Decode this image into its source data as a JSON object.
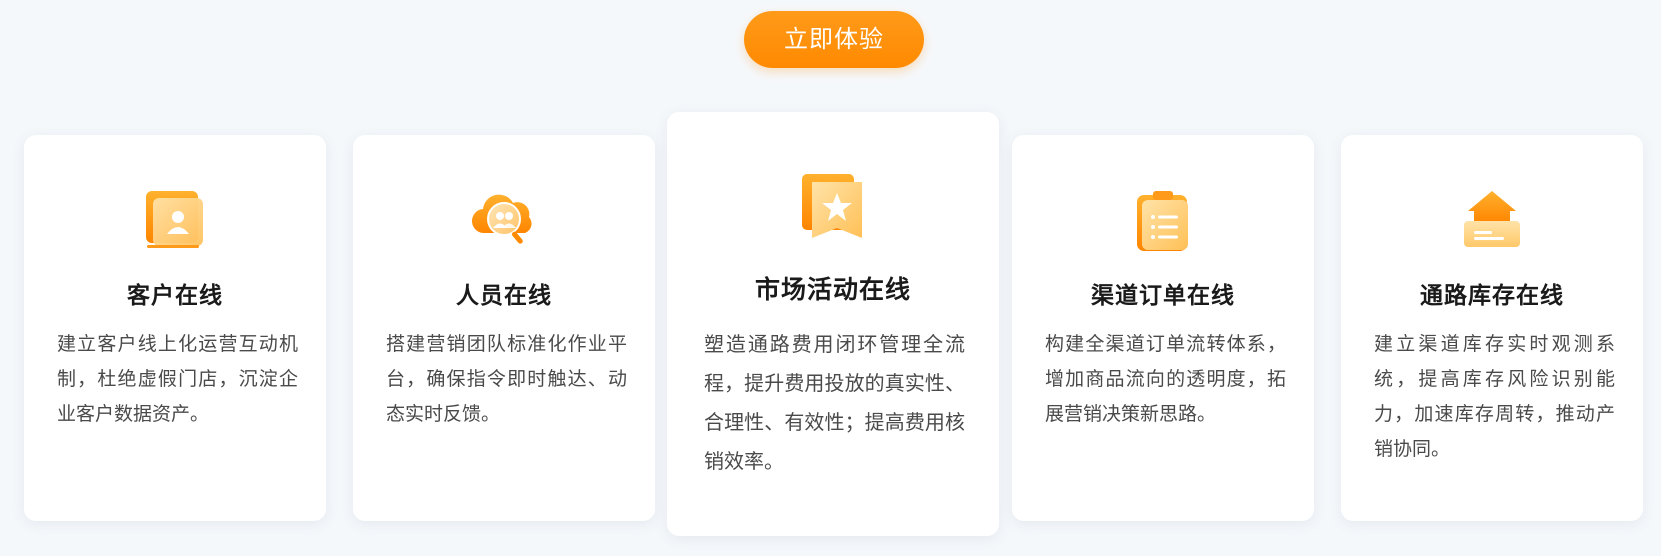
{
  "cta": {
    "label": "立即体验"
  },
  "colors": {
    "accent": "#ff8a00",
    "background": "#f5f8fb",
    "card": "#ffffff"
  },
  "cards": [
    {
      "icon": "monitor-user-icon",
      "title": "客户在线",
      "desc": "建立客户线上化运营互动机制，杜绝虚假门店，沉淀企业客户数据资产。"
    },
    {
      "icon": "search-users-icon",
      "title": "人员在线",
      "desc": "搭建营销团队标准化作业平台，确保指令即时触达、动态实时反馈。"
    },
    {
      "icon": "star-badge-icon",
      "title": "市场活动在线",
      "desc": "塑造通路费用闭环管理全流程，提升费用投放的真实性、合理性、有效性；提高费用核销效率。"
    },
    {
      "icon": "clipboard-list-icon",
      "title": "渠道订单在线",
      "desc": "构建全渠道订单流转体系，增加商品流向的透明度，拓展营销决策新思路。"
    },
    {
      "icon": "warehouse-icon",
      "title": "通路库存在线",
      "desc": "建立渠道库存实时观测系统，提高库存风险识别能力，加速库存周转，推动产销协同。"
    }
  ]
}
